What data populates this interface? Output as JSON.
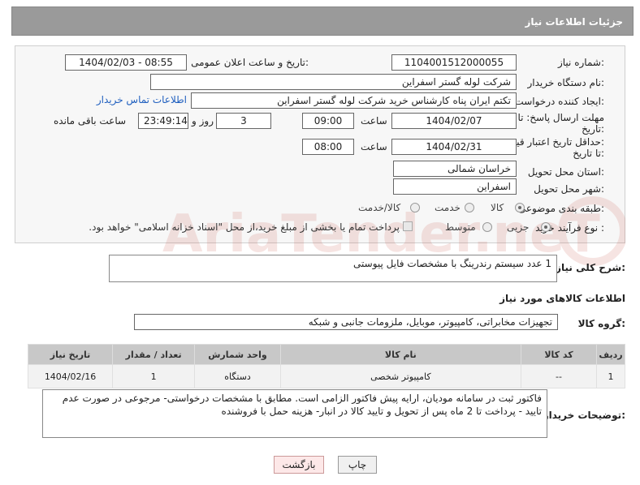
{
  "header": {
    "title": "جزئیات اطلاعات نیاز"
  },
  "form": {
    "need_number": {
      "label": "شماره نیاز:",
      "value": "1104001512000055"
    },
    "announce_datetime": {
      "label": "تاریخ و ساعت اعلان عمومی:",
      "value": "1404/02/03 - 08:55"
    },
    "buyer_org": {
      "label": "نام دستگاه خریدار:",
      "value": "شرکت لوله گستر اسفراین"
    },
    "requester": {
      "label": "ایجاد کننده درخواست:",
      "value": "تکتم ایران پناه کارشناس خرید شرکت لوله گستر اسفراین",
      "contact_link": "اطلاعات تماس خریدار"
    },
    "reply_deadline": {
      "label_line1": "مهلت ارسال پاسخ: تا",
      "label_line2": "تاریخ:",
      "date": "1404/02/07",
      "time_label": "ساعت",
      "time": "09:00",
      "days": "3",
      "days_label": "روز و",
      "remaining": "23:49:14",
      "remaining_label": "ساعت باقی مانده"
    },
    "price_validity": {
      "label_line1": "حداقل تاریخ اعتبار قیمت:",
      "label_line2": "تا تاریخ:",
      "date": "1404/02/31",
      "time_label": "ساعت",
      "time": "08:00"
    },
    "delivery_province": {
      "label": "استان محل تحویل:",
      "value": "خراسان شمالی"
    },
    "delivery_city": {
      "label": "شهر محل تحویل:",
      "value": "اسفراین"
    },
    "category": {
      "label": "طبقه بندی موضوعی:",
      "options": [
        "کالا",
        "خدمت",
        "کالا/خدمت"
      ],
      "selected": "کالا"
    },
    "purchase_process": {
      "label": "نوع فرآیند خرید :",
      "options": [
        "جزیی",
        "متوسط"
      ],
      "selected": "جزیی",
      "treasury_note": "پرداخت تمام یا بخشی از مبلغ خرید،از محل \"اسناد خزانه اسلامی\" خواهد بود."
    }
  },
  "description": {
    "label": "شرح کلی نیاز:",
    "value": "1 عدد سیستم رندرینگ با مشخصات فایل پیوستی"
  },
  "goods_info": {
    "title": "اطلاعات کالاهای مورد نیاز",
    "group_label": "گروه کالا:",
    "group_value": "تجهیزات مخابراتی، کامپیوتر، موبایل، ملزومات جانبی و شبکه"
  },
  "table": {
    "headers": [
      "ردیف",
      "کد کالا",
      "نام کالا",
      "واحد شمارش",
      "تعداد / مقدار",
      "تاریخ نیاز"
    ],
    "rows": [
      [
        "1",
        "--",
        "کامپیوتر شخصی",
        "دستگاه",
        "1",
        "1404/02/16"
      ]
    ]
  },
  "buyer_notes": {
    "label": "توضیحات خریدار:",
    "value": "فاکتور ثبت در سامانه مودیان، ارایه پیش فاکتور الزامی است. مطابق با مشخصات درخواستی- مرجوعی در صورت عدم تایید - پرداخت تا 2 ماه پس از تحویل و تایید کالا در انبار- هزینه حمل با فروشنده"
  },
  "buttons": {
    "print": "چاپ",
    "back": "بازگشت"
  },
  "watermark": {
    "text": "AriaTender.neT"
  },
  "colors": {
    "header_bg": "#9a9a9a",
    "link": "#1f5fbf",
    "back_button_bg": "#fde8e8"
  }
}
